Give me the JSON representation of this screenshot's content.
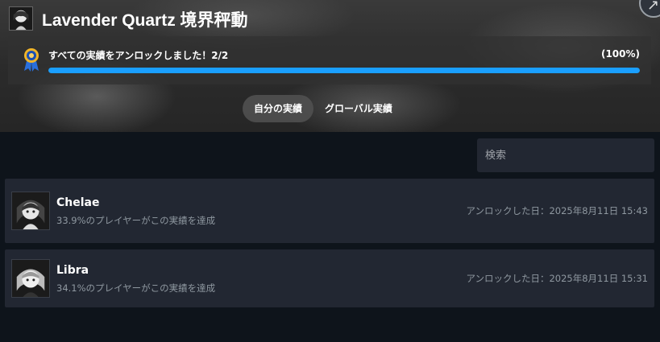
{
  "header": {
    "game_title": "Lavender Quartz 境界秤動",
    "game_icon": "game-portrait-icon"
  },
  "progress": {
    "label": "すべての実績をアンロックしました！2/2",
    "percent_text": "(100%)",
    "fraction": 1.0,
    "icon": "medal-icon",
    "bar_color": "#1a9fff"
  },
  "tabs": [
    {
      "label": "自分の実績",
      "active": true
    },
    {
      "label": "グローバル実績",
      "active": false
    }
  ],
  "search": {
    "placeholder": "検索"
  },
  "achievements": [
    {
      "name": "Chelae",
      "description": "33.9%のプレイヤーがこの実績を達成",
      "unlocked": "アンロックした日：2025年8月11日 15:43",
      "icon": "chelae-achievement-icon"
    },
    {
      "name": "Libra",
      "description": "34.1%のプレイヤーがこの実績を達成",
      "unlocked": "アンロックした日：2025年8月11日 15:31",
      "icon": "libra-achievement-icon"
    }
  ],
  "colors": {
    "accent": "#1a9fff",
    "background": "#0e141b",
    "row_background": "#222732"
  }
}
